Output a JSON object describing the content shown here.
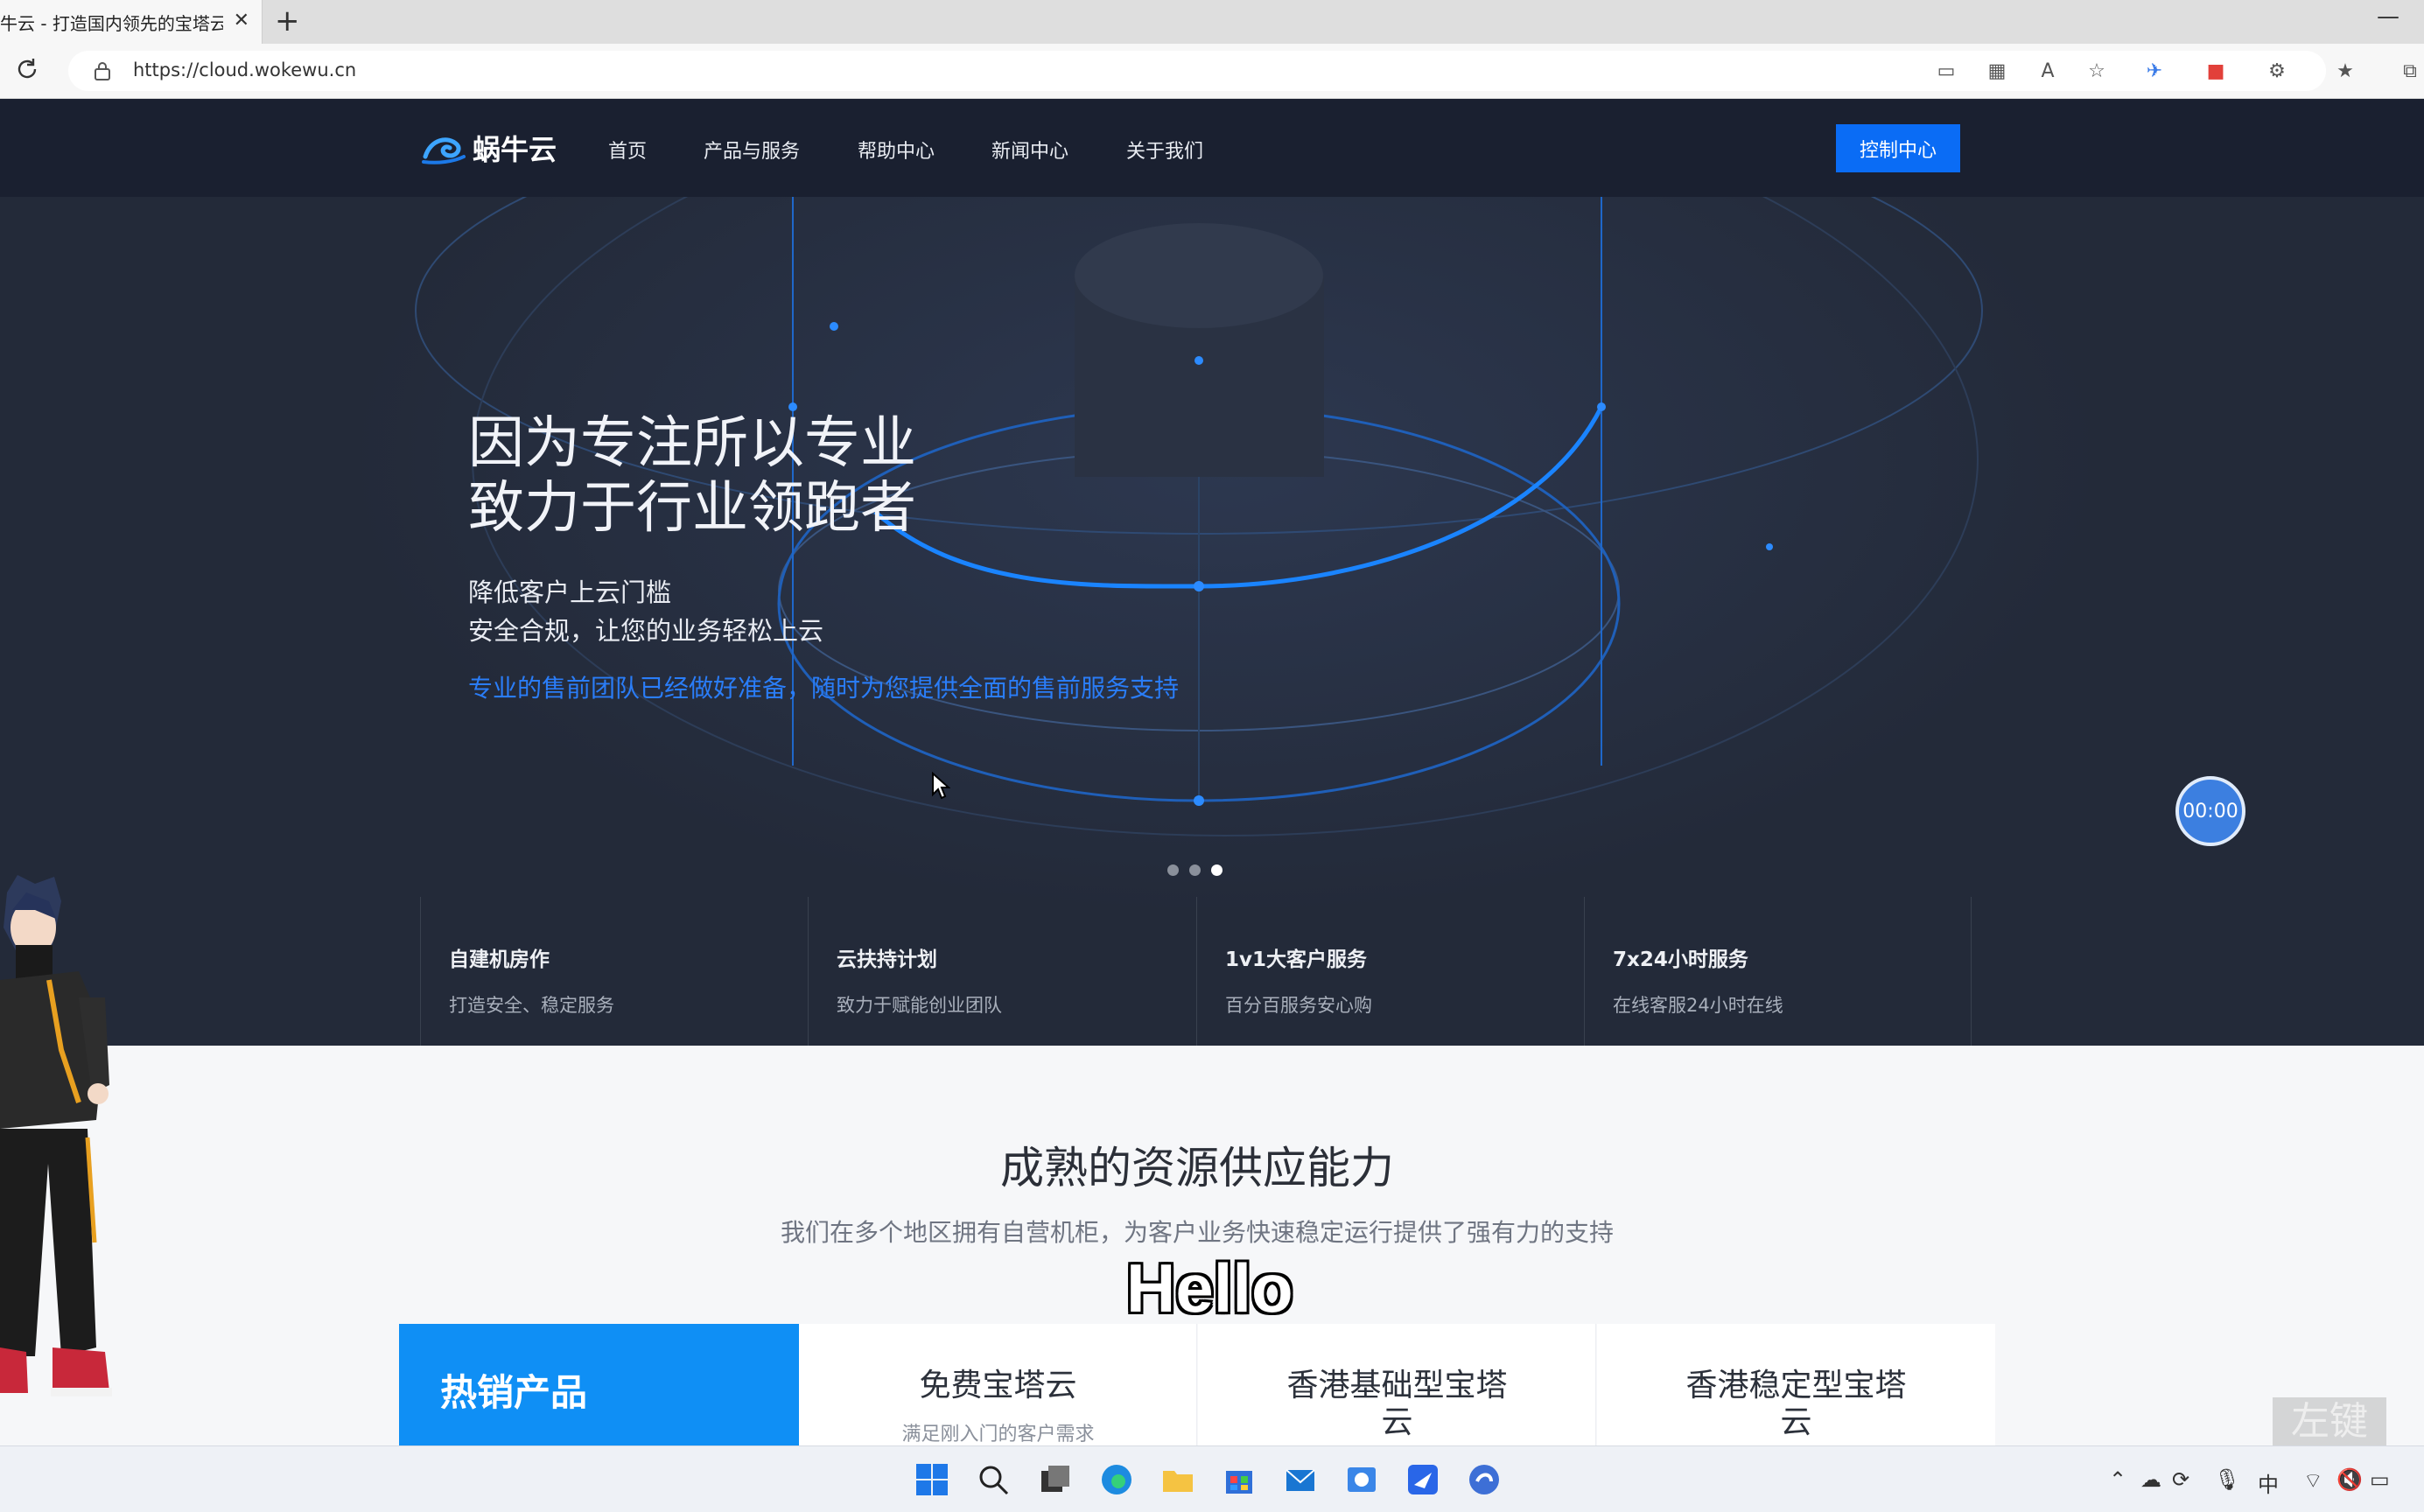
{
  "browser": {
    "tab_title": "牛云 - 打造国内领先的宝塔云",
    "tab_close": "✕",
    "new_tab": "+",
    "minimize": "—",
    "url": "https://cloud.wokewu.cn"
  },
  "site": {
    "logo": "蜗牛云",
    "nav": [
      "首页",
      "产品与服务",
      "帮助中心",
      "新闻中心",
      "关于我们"
    ],
    "console_button": "控制中心"
  },
  "hero": {
    "headline_1": "因为专注所以专业",
    "headline_2": "致力于行业领跑者",
    "sub_1": "降低客户上云门槛",
    "sub_2": "安全合规，让您的业务轻松上云",
    "blue_text": "专业的售前团队已经做好准备，随时为您提供全面的售前服务支持",
    "timer": "00:00",
    "carousel_active_index": 2,
    "features": [
      {
        "title": "自建机房作",
        "desc": "打造安全、稳定服务"
      },
      {
        "title": "云扶持计划",
        "desc": "致力于赋能创业团队"
      },
      {
        "title": "1v1大客户服务",
        "desc": "百分百服务安心购"
      },
      {
        "title": "7x24小时服务",
        "desc": "在线客服24小时在线"
      }
    ]
  },
  "content": {
    "title": "成熟的资源供应能力",
    "subtitle": "我们在多个地区拥有自营机柜，为客户业务快速稳定运行提供了强有力的支持",
    "overlay_caption": "Hello",
    "hot_label": "热销产品",
    "products": [
      {
        "title": "免费宝塔云",
        "desc": "满足刚入门的客户需求"
      },
      {
        "title": "香港基础型宝塔云",
        "desc": ""
      },
      {
        "title": "香港稳定型宝塔云",
        "desc": ""
      }
    ]
  },
  "watermark": "左键",
  "tray": {
    "ime": "中"
  }
}
